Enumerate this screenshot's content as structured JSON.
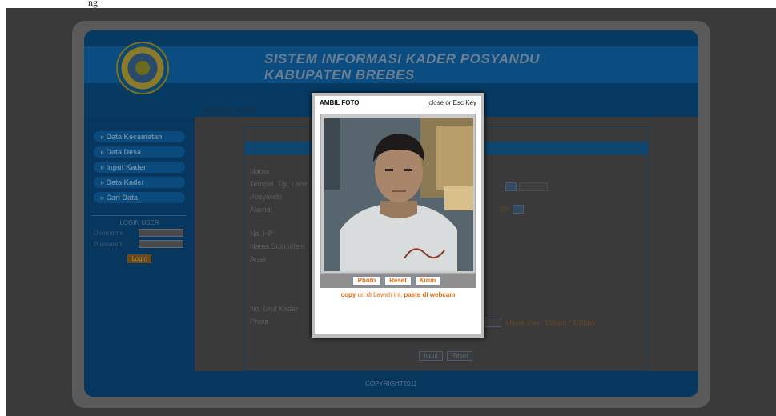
{
  "caption_fragment": "ng",
  "header": {
    "title_line1": "SISTEM INFORMASI KADER POSYANDU",
    "title_line2": "KABUPATEN BREBES"
  },
  "breadcrumb": "ESSENCE STORE",
  "sidebar": {
    "items": [
      {
        "label": "» Data Kecamatan"
      },
      {
        "label": "» Data Desa"
      },
      {
        "label": "» Input Kader"
      },
      {
        "label": "» Data Kader"
      },
      {
        "label": "» Cari Data"
      }
    ],
    "login": {
      "title": "LOGIN USER",
      "username_label": "Username",
      "password_label": "Password",
      "button": "Login"
    }
  },
  "form": {
    "labels": {
      "nama": "Nama",
      "tempat": "Tempat, Tgl. Lahir",
      "posyandu": "Posyandu",
      "alamat": "Alamat",
      "no_hp": "No. HP",
      "suami": "Nama Suami/Istri",
      "anak": "Anak",
      "no_urut": "No. Urut Kader",
      "photo": "Photo"
    },
    "rt_value": "RT",
    "photo_hint": "ukuran max : 150(px) * 150(px)",
    "input_button": "Input",
    "reset_button": "Reset"
  },
  "modal": {
    "title": "AMBIL FOTO",
    "close_link": "close",
    "close_suffix": " or Esc Key",
    "buttons": {
      "photo": "Photo",
      "reset": "Reset",
      "kirim": "Kirim"
    },
    "hint_copy": "copy",
    "hint_mid": " url di bawah ini, ",
    "hint_paste": "paste di webcam"
  },
  "footer": {
    "copyright": "COPYRIGHT2011"
  },
  "colors": {
    "accent_orange": "#e06a10",
    "header_blue": "#0b4d80"
  }
}
